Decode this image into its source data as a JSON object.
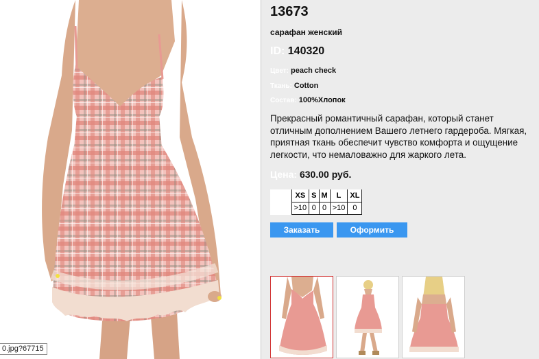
{
  "product": {
    "article": "13673",
    "name": "сарафан женский",
    "id_label": "ID:",
    "id_value": "140320",
    "color_label": "Цвет:",
    "color_value": "peach check",
    "fabric_label": "Ткань:",
    "fabric_value": "Cotton",
    "composition_label": "Состав:",
    "composition_value": "100%Хлопок",
    "description": "Прекрасный романтичный сарафан, который станет отличным дополнением Вашего летнего гардероба. Мягкая, приятная ткань обеспечит чувство комфорта и ощущение легкости, что немаловажно для жаркого лета.",
    "price_label": "Цена:",
    "price_value": "630.00 руб."
  },
  "sizes": {
    "headers": [
      "XS",
      "S",
      "M",
      "L",
      "XL"
    ],
    "stock": [
      ">10",
      "0",
      "0",
      ">10",
      "0"
    ]
  },
  "buttons": {
    "order": "Заказать",
    "checkout": "Оформить"
  },
  "photo": {
    "tooltip": "0.jpg?67715"
  },
  "thumbnails": [
    {
      "icon": "dress-front-thumbnail",
      "selected": true
    },
    {
      "icon": "dress-full-thumbnail",
      "selected": false
    },
    {
      "icon": "dress-back-thumbnail",
      "selected": false
    }
  ],
  "colors": {
    "panel_bg": "#ececec",
    "label_white": "#ffffff",
    "button_blue": "#3a97f0",
    "thumb_selected_border": "#d13030",
    "dress_pink": "#e89a93"
  }
}
